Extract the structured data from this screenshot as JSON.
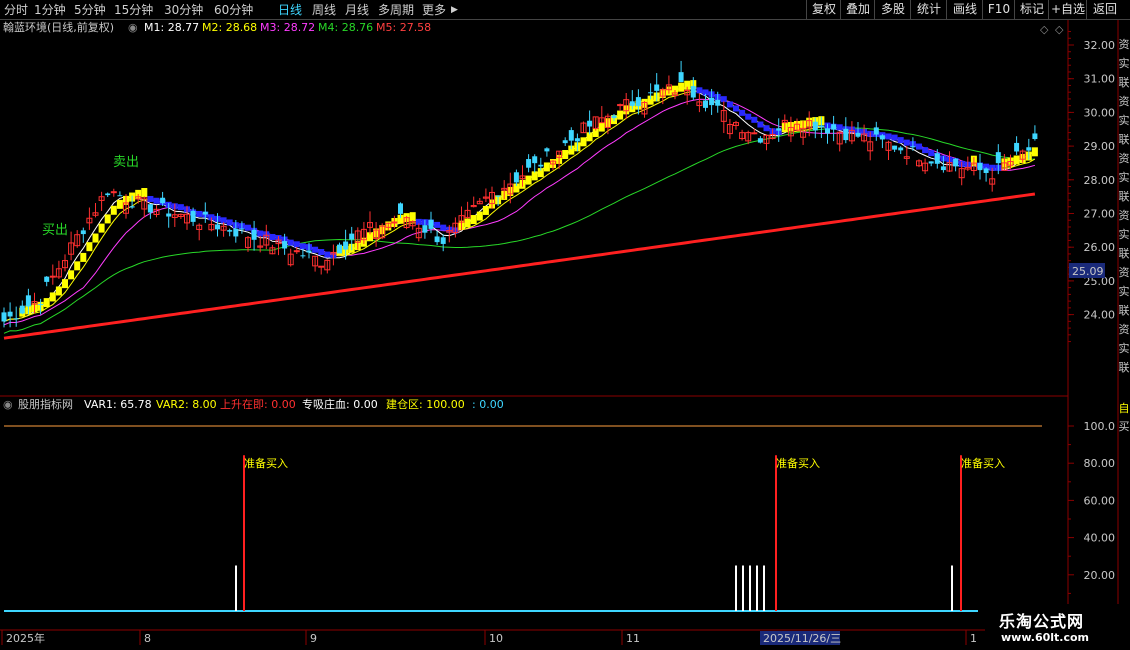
{
  "toolbar": {
    "periods": [
      {
        "label": "分时",
        "active": false
      },
      {
        "label": "1分钟",
        "active": false
      },
      {
        "label": "5分钟",
        "active": false
      },
      {
        "label": "15分钟",
        "active": false
      },
      {
        "label": "30分钟",
        "active": false
      },
      {
        "label": "60分钟",
        "active": false
      },
      {
        "label": "日线",
        "active": true
      },
      {
        "label": "周线",
        "active": false
      },
      {
        "label": "月线",
        "active": false
      },
      {
        "label": "多周期",
        "active": false
      },
      {
        "label": "更多",
        "active": false
      }
    ],
    "right_buttons": [
      "复权",
      "叠加",
      "多股",
      "统计",
      "画线",
      "F10",
      "标记",
      "+自选",
      "返回"
    ]
  },
  "main_legend": {
    "stock": "翰蓝环境(日线,前复权)",
    "ma": [
      {
        "label": "M1: 28.77",
        "color": "#ffffff"
      },
      {
        "label": "M2: 28.68",
        "color": "#ffff00"
      },
      {
        "label": "M3: 28.72",
        "color": "#ff3cff"
      },
      {
        "label": "M4: 28.76",
        "color": "#28d828"
      },
      {
        "label": "M5: 27.58",
        "color": "#ff4040"
      }
    ]
  },
  "indicator_legend": {
    "name": "股朋指标网",
    "items": [
      {
        "label": "VAR1: 65.78",
        "color": "#ffffff"
      },
      {
        "label": "VAR2: 8.00",
        "color": "#ffff00"
      },
      {
        "label": "上升在即: 0.00",
        "color": "#ff3030"
      },
      {
        "label": "专吸庄血: 0.00",
        "color": "#ffffff"
      },
      {
        "label": "建仓区: 100.00",
        "color": "#ffff00"
      },
      {
        "label": ": 0.00",
        "color": "#3ed6ff"
      }
    ]
  },
  "price_axis": {
    "ticks": [
      "32.00",
      "31.00",
      "30.00",
      "29.00",
      "28.00",
      "27.00",
      "26.00",
      "25.00",
      "24.00"
    ],
    "current_price": "25.09"
  },
  "indicator_axis": {
    "ticks": [
      "100.0",
      "80.00",
      "60.00",
      "40.00",
      "20.00"
    ]
  },
  "date_axis": {
    "labels": [
      "2025年",
      "8",
      "9",
      "10",
      "11",
      "1"
    ],
    "cursor_date": "2025/11/26/三"
  },
  "annotations": {
    "sell_label": "卖出",
    "buy_label": "买出",
    "prepare_buy": "准备买入"
  },
  "right_strip_text": "资实联资实联资实联资实联资实联资实联",
  "indicator_right_strip": "自买",
  "watermark": {
    "line1": "乐淘公式网",
    "line2": "www.60lt.com"
  },
  "chart_data": {
    "type": "candlestick",
    "ylim": [
      23.0,
      32.4
    ],
    "ma_lines_color": {
      "M1": "#ffffff",
      "M2": "#ffff00",
      "M3": "#ff3cff",
      "M4": "#28d828",
      "M5": "#ff3030"
    },
    "indicator_ylim": [
      0,
      110
    ],
    "indicator_reference_line": 100,
    "prepare_buy_signals": [
      {
        "x_index": 36,
        "value": 80
      },
      {
        "x_index": 114,
        "value": 80
      },
      {
        "x_index": 145,
        "value": 80
      }
    ],
    "white_signals_x_index": [
      35,
      109,
      110,
      111,
      112,
      113,
      144
    ]
  }
}
